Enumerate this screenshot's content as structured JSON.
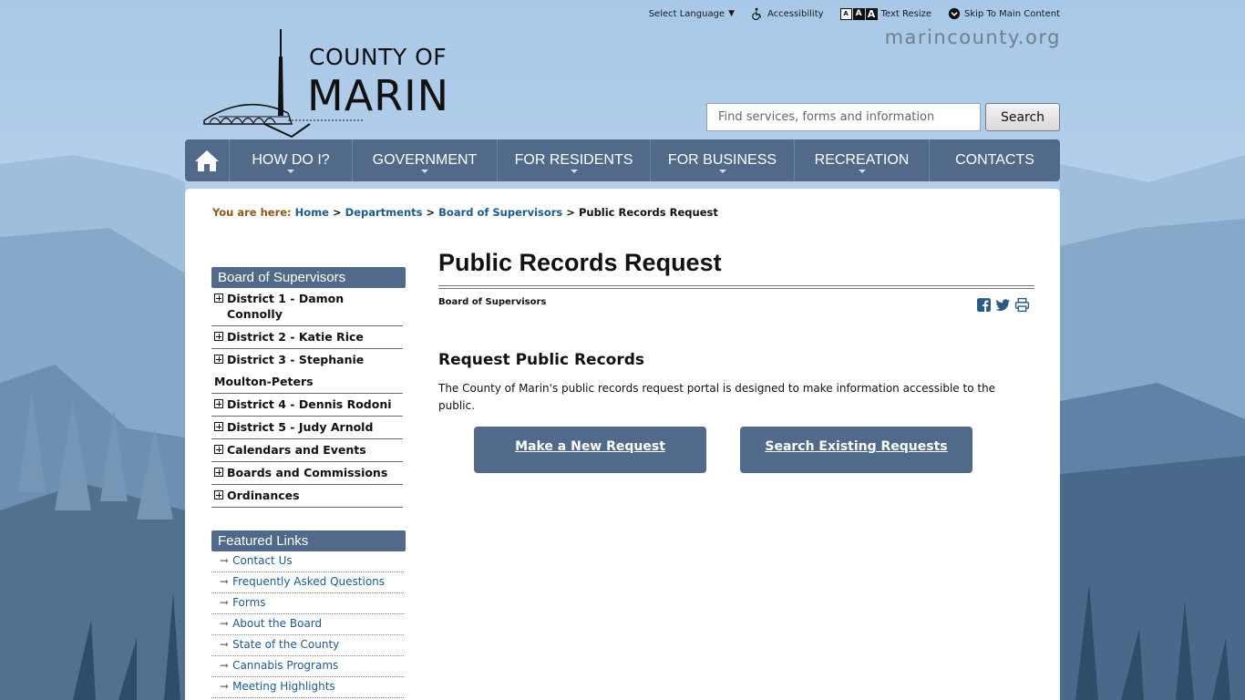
{
  "utility": {
    "language": "Select Language",
    "accessibility": "Accessibility",
    "text_resize": "Text Resize",
    "skip": "Skip To Main Content",
    "aaa": [
      "A",
      "A",
      "A"
    ]
  },
  "domain": "marincounty.org",
  "logo": {
    "line1": "COUNTY OF",
    "line2": "MARIN"
  },
  "search": {
    "placeholder": "Find services, forms and information",
    "button": "Search"
  },
  "nav": {
    "items": [
      {
        "label": "HOW DO I?",
        "dropdown": true
      },
      {
        "label": "GOVERNMENT",
        "dropdown": true
      },
      {
        "label": "FOR RESIDENTS",
        "dropdown": true
      },
      {
        "label": "FOR BUSINESS",
        "dropdown": true
      },
      {
        "label": "RECREATION",
        "dropdown": true
      },
      {
        "label": "CONTACTS",
        "dropdown": false
      }
    ]
  },
  "breadcrumb": {
    "lead": "You are here:",
    "home": "Home",
    "departments": "Departments",
    "board": "Board of Supervisors",
    "current": "Public Records Request",
    "sep": ">"
  },
  "sidebar": {
    "title": "Board of Supervisors",
    "items": [
      "District 1 - Damon Connolly",
      "District 2 - Katie Rice",
      "District 3 - Stephanie",
      "District 4 - Dennis Rodoni",
      "District 5 - Judy Arnold",
      "Calendars and Events",
      "Boards and Commissions",
      "Ordinances"
    ],
    "item3_wrap": "Moulton-Peters"
  },
  "featured": {
    "title": "Featured Links",
    "items": [
      "Contact Us",
      "Frequently Asked Questions",
      "Forms",
      "About the Board",
      "State of the County",
      "Cannabis Programs",
      "Meeting Highlights"
    ],
    "arrow": "➞"
  },
  "main": {
    "title": "Public Records Request",
    "department": "Board of Supervisors",
    "subtitle": "Request Public Records",
    "description": "The County of Marin's public records request portal is designed to make information accessible to the public.",
    "buttons": {
      "new": "Make a New Request",
      "search": "Search Existing Requests"
    }
  },
  "colors": {
    "nav": "#516a8a",
    "link": "#1f5a8a",
    "breadcrumb_lead": "#8a5a16",
    "sky": "#b9d4ec"
  }
}
